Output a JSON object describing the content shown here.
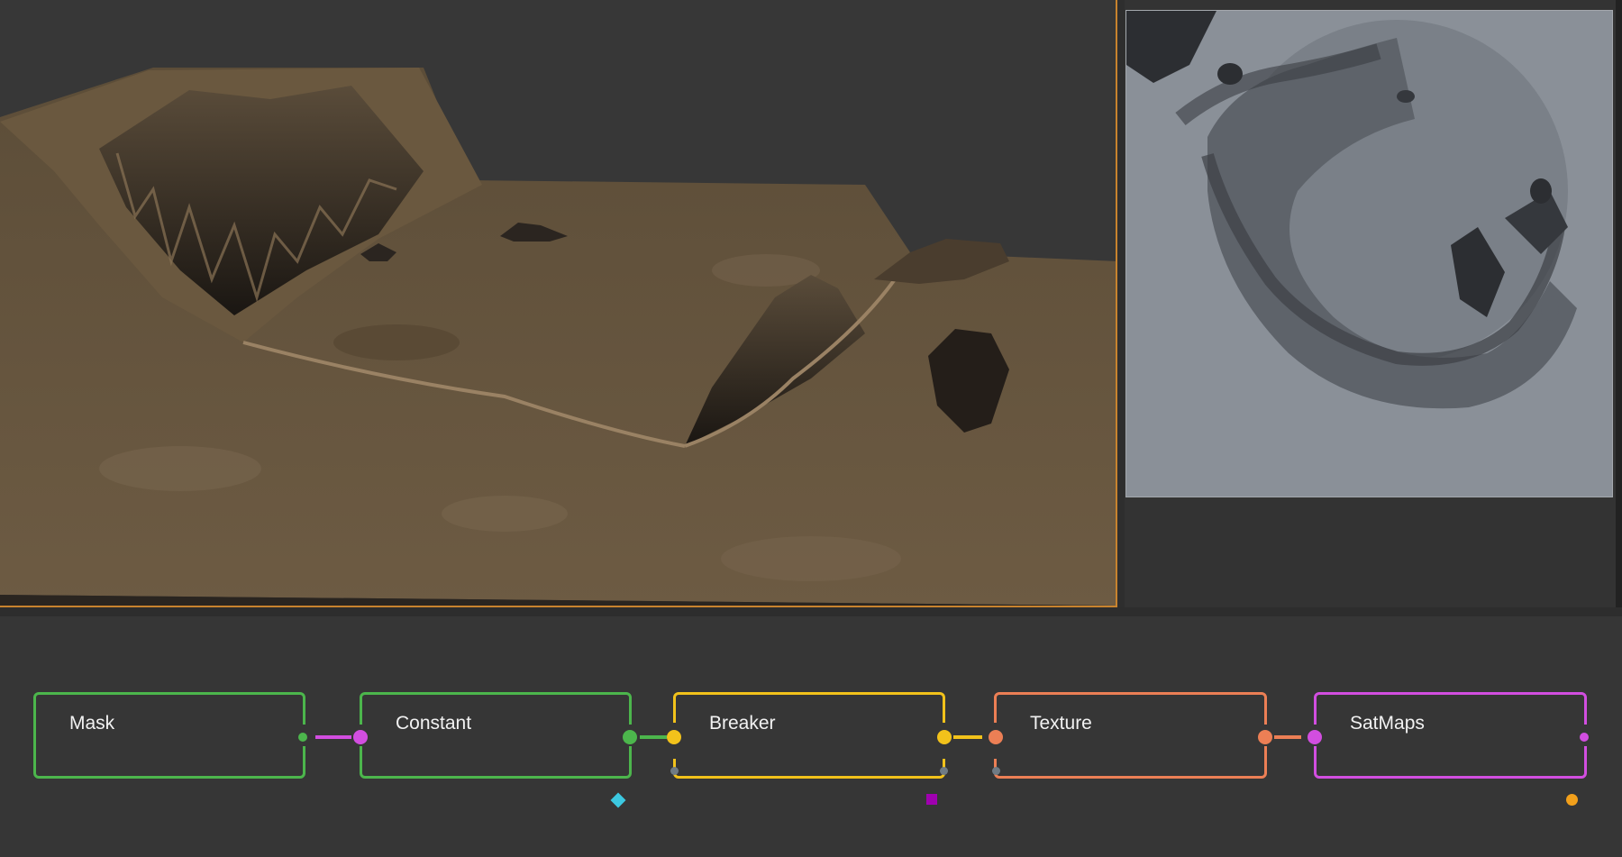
{
  "nodes": [
    {
      "id": "mask",
      "label": "Mask",
      "color": "#4cb64c"
    },
    {
      "id": "constant",
      "label": "Constant",
      "color": "#4cb64c"
    },
    {
      "id": "breaker",
      "label": "Breaker",
      "color": "#f2c21b"
    },
    {
      "id": "texture",
      "label": "Texture",
      "color": "#ec7f55"
    },
    {
      "id": "satmaps",
      "label": "SatMaps",
      "color": "#d24ee0"
    }
  ],
  "colors": {
    "accent_frame": "#c8832e",
    "terrain": "#6b5a42",
    "diamond_marker": "#3cc8e0",
    "square_marker": "#a000b0",
    "dot_marker": "#f2a01b",
    "port_gray": "#6f7b85"
  },
  "icons": {
    "viewport3d": "terrain-3d-preview",
    "viewport2d": "heightmap-2d-preview",
    "diamond": "diamond-marker-icon",
    "square": "square-marker-icon",
    "dot": "dot-marker-icon"
  }
}
